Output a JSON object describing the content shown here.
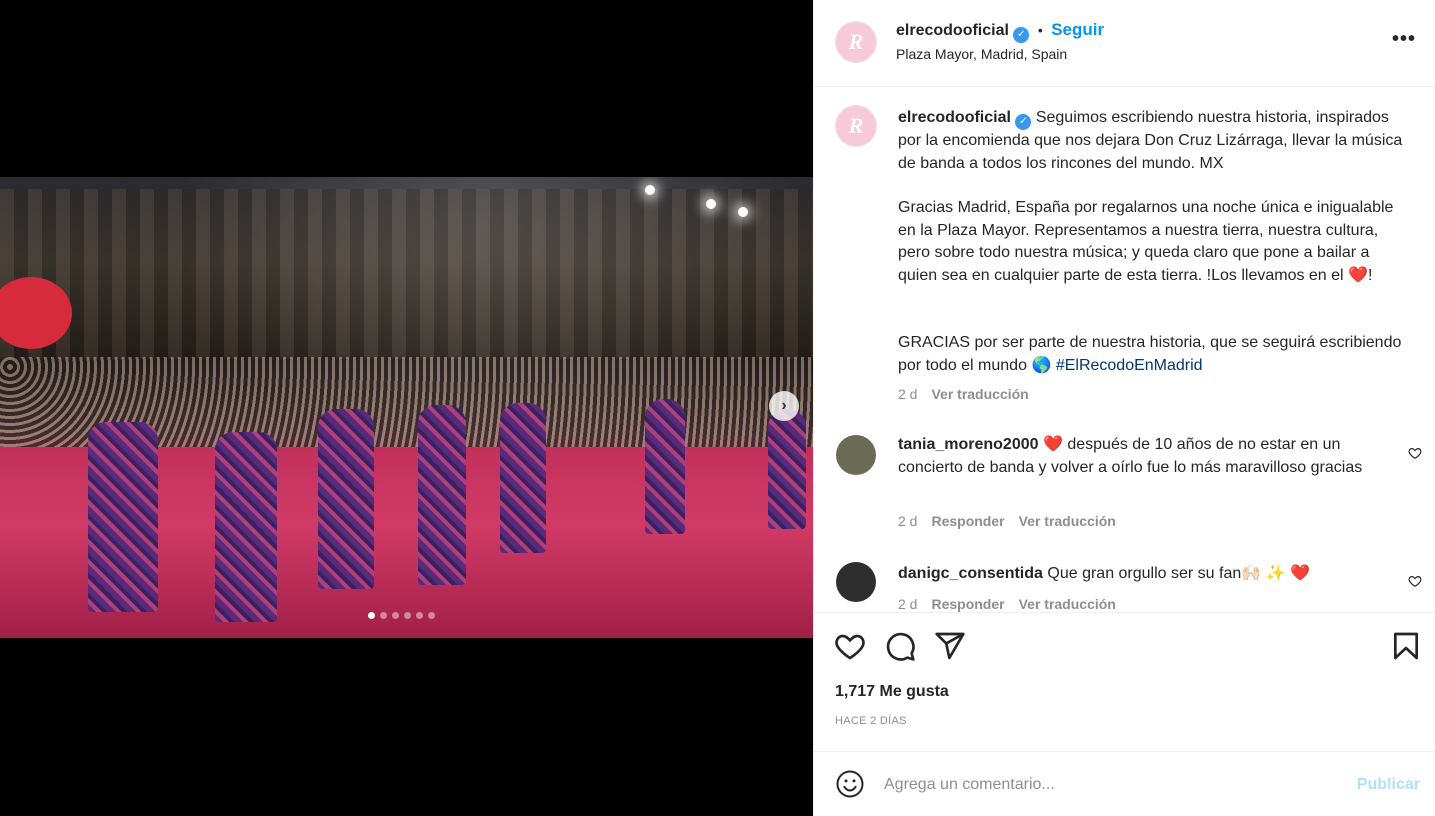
{
  "post": {
    "author": "elrecodooficial",
    "avatar_letter": "R",
    "follow_label": "Seguir",
    "separator": "•",
    "location": "Plaza Mayor, Madrid, Spain",
    "more_label": "•••",
    "carousel": {
      "total_slides": 6,
      "active_index": 0,
      "next_label": "›"
    }
  },
  "caption": {
    "username": "elrecodooficial",
    "paragraph_1": "Seguimos escribiendo nuestra historia, inspirados por la encomienda que nos dejara Don Cruz Lizárraga, llevar la música de banda a todos los rincones del mundo. MX",
    "paragraph_2_a": "Gracias Madrid, España por regalarnos una noche única e inigualable en la Plaza Mayor. Representamos a nuestra tierra, nuestra cultura, pero sobre todo nuestra música; y queda claro que pone a bailar a quien sea en cualquier parte de esta tierra. !Los llevamos en el",
    "paragraph_2_heart": "❤️",
    "paragraph_2_b": "!",
    "paragraph_3_a": "GRACIAS por ser parte de nuestra historia, que se seguirá escribiendo por todo el mundo",
    "paragraph_3_globe": "🌎",
    "hashtag": "#ElRecodoEnMadrid",
    "time": "2 d",
    "translate_label": "Ver traducción"
  },
  "comments": [
    {
      "username": "tania_moreno2000",
      "heart": "❤️",
      "text": "después de 10 años de no estar en un concierto de banda y volver a oírlo fue lo más maravilloso gracias",
      "time": "2 d",
      "reply_label": "Responder",
      "translate_label": "Ver traducción"
    },
    {
      "username": "danigc_consentida",
      "text": "Que gran orgullo ser su fan🙌🏻 ✨ ❤️",
      "time": "2 d",
      "reply_label": "Responder",
      "translate_label": "Ver traducción"
    }
  ],
  "stats": {
    "likes": "1,717 Me gusta",
    "date": "HACE 2 DÍAS"
  },
  "add_comment": {
    "placeholder": "Agrega un comentario...",
    "publish_label": "Publicar"
  },
  "colors": {
    "accent": "#0095f6",
    "verified": "#3897f0",
    "hashtag": "#00376b",
    "heart": "#ed1c3a",
    "publish_disabled": "#b2dffc"
  },
  "icons": [
    "verified-icon",
    "more-options-icon",
    "next-slide-icon",
    "like-icon",
    "comment-icon",
    "share-icon",
    "save-icon",
    "emoji-icon",
    "comment-like-icon"
  ]
}
